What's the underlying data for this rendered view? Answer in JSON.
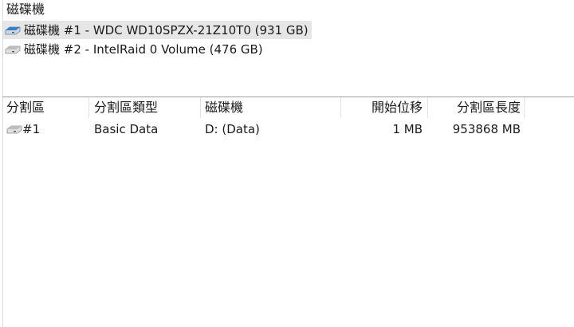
{
  "disks_panel": {
    "title": "磁碟機",
    "disks": [
      {
        "label": "磁碟機 #1 - WDC WD10SPZX-21Z10T0 (931 GB)",
        "icon": "hdd-icon",
        "selected": true
      },
      {
        "label": "磁碟機 #2 - IntelRaid 0 Volume (476 GB)",
        "icon": "hdd-icon",
        "selected": false
      }
    ]
  },
  "partitions_table": {
    "columns": [
      "分割區",
      "分割區類型",
      "磁碟機",
      "開始位移",
      "分割區長度"
    ],
    "rows": [
      {
        "partition": "#1",
        "type": "Basic Data",
        "drive": "D: (Data)",
        "offset": "1 MB",
        "length": "953868 MB"
      }
    ]
  },
  "colors": {
    "selection_bg": "#e6e6e6",
    "drive_icon_selected": "#3b7fc4",
    "drive_icon": "#9a9a9a"
  }
}
